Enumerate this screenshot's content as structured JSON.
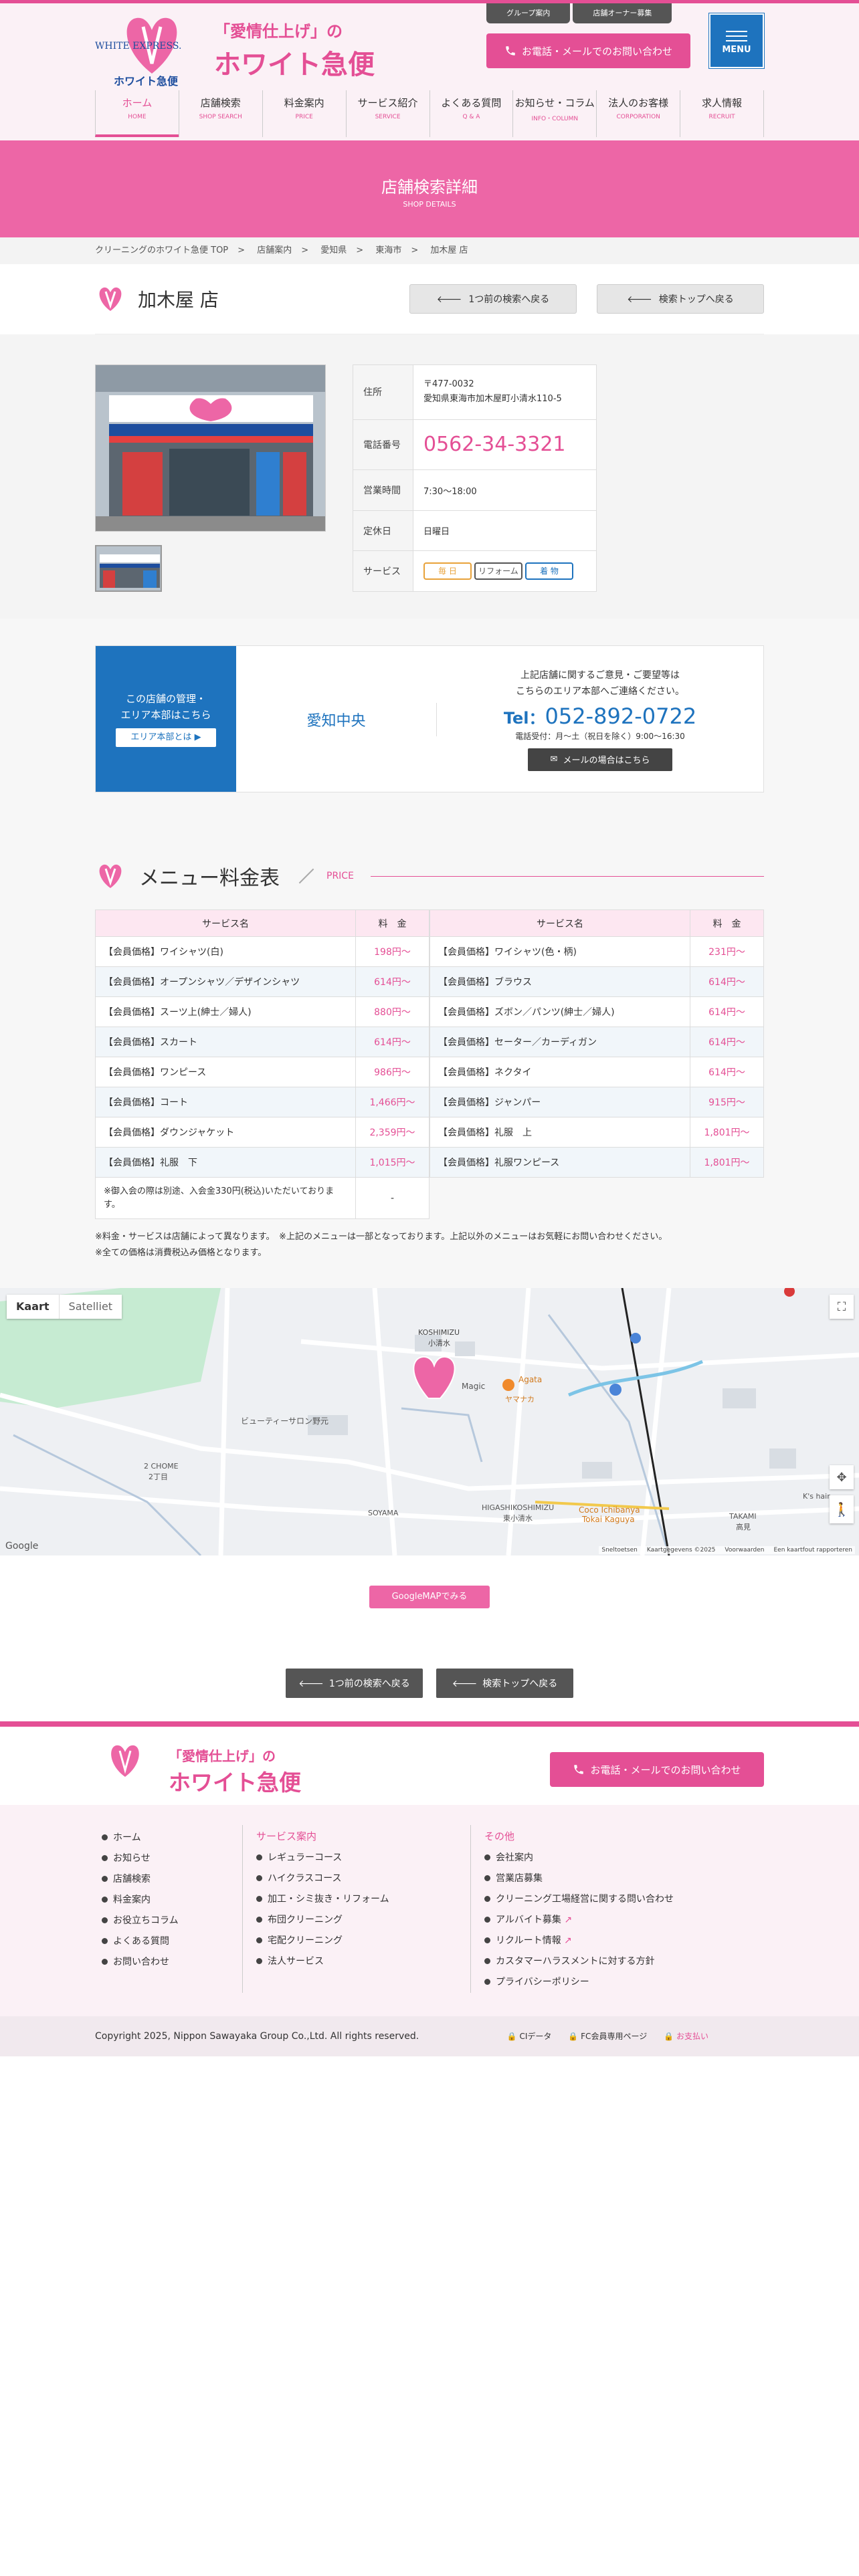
{
  "header": {
    "logo_en": "WHITE EXPRESS.",
    "logo_jp": "ホワイト急便",
    "tagline1": "「愛情仕上げ」の",
    "tagline2": "ホワイト急便",
    "group_links": [
      "グループ案内",
      "店舗オーナー募集"
    ],
    "contact_label": "お電話・メールでのお問い合わせ",
    "menu_label": "MENU",
    "nav": [
      {
        "jp": "ホーム",
        "en": "HOME"
      },
      {
        "jp": "店舗検索",
        "en": "SHOP SEARCH"
      },
      {
        "jp": "料金案内",
        "en": "PRICE"
      },
      {
        "jp": "サービス紹介",
        "en": "SERVICE"
      },
      {
        "jp": "よくある質問",
        "en": "Q & A"
      },
      {
        "jp": "お知らせ・コラム",
        "en": "INFO・COLUMN"
      },
      {
        "jp": "法人のお客様",
        "en": "CORPORATION"
      },
      {
        "jp": "求人情報",
        "en": "RECRUIT"
      }
    ]
  },
  "page_title": {
    "jp": "店舗検索詳細",
    "en": "SHOP DETAILS"
  },
  "breadcrumb": [
    "クリーニングのホワイト急便 TOP",
    "店舗案内",
    "愛知県",
    "東海市",
    "加木屋 店"
  ],
  "store": {
    "name": "加木屋 店",
    "back_button": "1つ前の検索へ戻る",
    "top_button": "検索トップへ戻る",
    "address_label": "住所",
    "postal": "〒477-0032",
    "address": "愛知県東海市加木屋町小清水110-5",
    "phone_label": "電話番号",
    "phone": "0562-34-3321",
    "hours_label": "営業時間",
    "hours": "7:30～18:00",
    "holiday_label": "定休日",
    "holiday": "日曜日",
    "service_label": "サービス",
    "services": [
      {
        "label": "毎 日",
        "color": "#e8a23a"
      },
      {
        "label": "リフォーム",
        "color": "#555555"
      },
      {
        "label": "着 物",
        "color": "#1e73be"
      }
    ]
  },
  "management": {
    "left_line1": "この店舗の管理・",
    "left_line2": "エリア本部はこちら",
    "left_button": "エリア本部とは",
    "area": "愛知中央",
    "note1": "上記店舗に関するご意見・ご要望等は",
    "note2": "こちらのエリア本部へご連絡ください。",
    "tel_prefix": "Tel：",
    "tel": "052-892-0722",
    "hours": "電話受付：月〜土（祝日を除く）9:00〜16:30",
    "mail_button": "メールの場合はこちら"
  },
  "menu": {
    "title": "メニュー料金表",
    "en": "PRICE",
    "col_name": "サービス名",
    "col_price": "料　金",
    "left": [
      {
        "name": "【会員価格】ワイシャツ(白)",
        "price": "198円〜"
      },
      {
        "name": "【会員価格】オープンシャツ／デザインシャツ",
        "price": "614円〜"
      },
      {
        "name": "【会員価格】スーツ上(紳士／婦人)",
        "price": "880円〜"
      },
      {
        "name": "【会員価格】スカート",
        "price": "614円〜"
      },
      {
        "name": "【会員価格】ワンピース",
        "price": "986円〜"
      },
      {
        "name": "【会員価格】コート",
        "price": "1,466円〜"
      },
      {
        "name": "【会員価格】ダウンジャケット",
        "price": "2,359円〜"
      },
      {
        "name": "【会員価格】礼服　下",
        "price": "1,015円〜"
      },
      {
        "name": "※御入会の際は別途、入会金330円(税込)いただいております。",
        "price": "-"
      }
    ],
    "right": [
      {
        "name": "【会員価格】ワイシャツ(色・柄)",
        "price": "231円〜"
      },
      {
        "name": "【会員価格】ブラウス",
        "price": "614円〜"
      },
      {
        "name": "【会員価格】ズボン／パンツ(紳士／婦人)",
        "price": "614円〜"
      },
      {
        "name": "【会員価格】セーター／カーディガン",
        "price": "614円〜"
      },
      {
        "name": "【会員価格】ネクタイ",
        "price": "614円〜"
      },
      {
        "name": "【会員価格】ジャンパー",
        "price": "915円〜"
      },
      {
        "name": "【会員価格】礼服　上",
        "price": "1,801円〜"
      },
      {
        "name": "【会員価格】礼服ワンピース",
        "price": "1,801円〜"
      }
    ],
    "note1": "※料金・サービスは店舗によって異なります。　※上記のメニューは一部となっております。上記以外のメニューはお気軽にお問い合わせください。",
    "note2": "※全ての価格は消費税込み価格となります。"
  },
  "map": {
    "tab_map": "Kaart",
    "tab_sat": "Satelliet",
    "labels": [
      "KOSHIMIZU",
      "小清水",
      "Magic",
      "ビューティーサロン野元",
      "2 CHOME",
      "2丁目",
      "SOYAMA",
      "HIGASHIKOSHIMIZU",
      "東小清水",
      "Coco Ichibanya",
      "Tokai Kaguya",
      "TAKAMI",
      "高見",
      "K's hair",
      "Agata",
      "ヤマナカ",
      "Google"
    ],
    "attrib": [
      "Sneltoetsen",
      "Kaartgegevens ©2025",
      "Voorwaarden",
      "Een kaartfout rapporteren"
    ],
    "button": "GoogleMAPでみる"
  },
  "bottom_buttons": [
    "1つ前の検索へ戻る",
    "検索トップへ戻る"
  ],
  "footer": {
    "tagline1": "「愛情仕上げ」の",
    "tagline2": "ホワイト急便",
    "contact_label": "お電話・メールでのお問い合わせ",
    "col1": [
      "ホーム",
      "お知らせ",
      "店舗検索",
      "料金案内",
      "お役立ちコラム",
      "よくある質問",
      "お問い合わせ"
    ],
    "col2_title": "サービス案内",
    "col2": [
      "レギュラーコース",
      "ハイクラスコース",
      "加工・シミ抜き・リフォーム",
      "布団クリーニング",
      "宅配クリーニング",
      "法人サービス"
    ],
    "col3_title": "その他",
    "col3": [
      "会社案内",
      "営業店募集",
      "クリーニング工場経営に関する問い合わせ",
      "アルバイト募集",
      "リクルート情報",
      "カスタマーハラスメントに対する方針",
      "プライバシーポリシー"
    ],
    "copyright": "Copyright 2025, Nippon Sawayaka Group Co.,Ltd. All rights reserved.",
    "bottom_links": [
      "CIデータ",
      "FC会員専用ページ",
      "お支払い"
    ]
  }
}
